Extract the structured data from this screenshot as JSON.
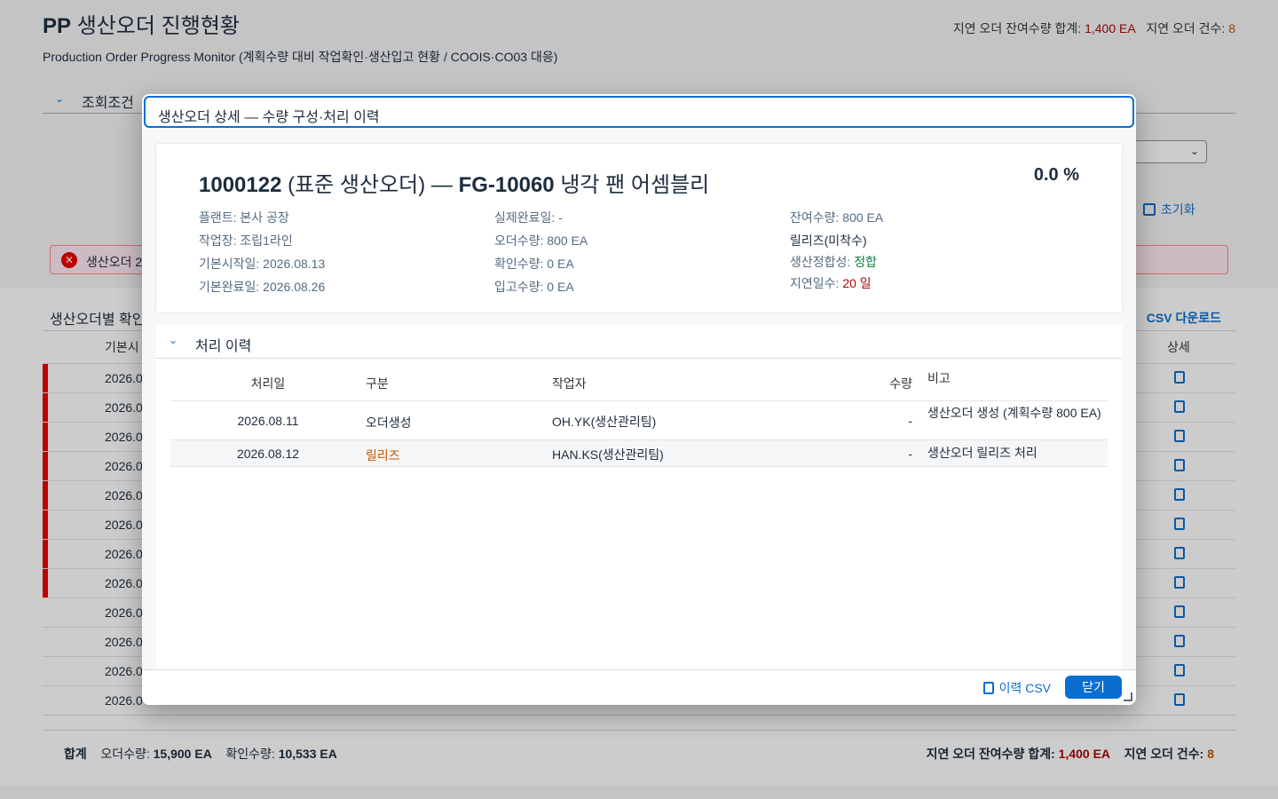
{
  "page": {
    "title_bold": "PP",
    "title_rest": "생산오더 진행현황",
    "subtitle": "Production Order Progress Monitor (계획수량 대비 작업확인·생산입고 현황 / COOIS·CO03 대응)",
    "kpi_label_1": "지연 오더 잔여수량 합계:",
    "kpi_value_1": "1,400 EA",
    "kpi_label_2": "지연 오더 건수:",
    "kpi_value_2": "8",
    "filter_label": "조회조건",
    "reset_label": "초기화",
    "error_text": "생산오더 2",
    "table_title": "생산오더별 확인",
    "csv_download": "CSV 다운로드",
    "col_start": "기본시",
    "col_detail": "상세",
    "row_dates": [
      "2026.0",
      "2026.0",
      "2026.0",
      "2026.0",
      "2026.0",
      "2026.0",
      "2026.0",
      "2026.0",
      "2026.0",
      "2026.0",
      "2026.0",
      "2026.0"
    ],
    "footer": {
      "sum_label": "합계",
      "order_qty_label": "오더수량:",
      "order_qty": "15,900 EA",
      "confirm_qty_label": "확인수량:",
      "confirm_qty": "10,533 EA",
      "delay_rem_label": "지연 오더 잔여수량 합계:",
      "delay_rem": "1,400 EA",
      "delay_cnt_label": "지연 오더 건수:",
      "delay_cnt": "8"
    }
  },
  "dialog": {
    "title": "생산오더 상세 — 수량 구성·처리 이력",
    "header_main": "1000122",
    "header_type": "(표준 생산오더) —",
    "header_material": "FG-10060",
    "header_desc": "냉각 팬 어셈블리",
    "percent": "0.0 %",
    "attrs_col1": [
      "플랜트: 본사 공장",
      "작업장: 조립1라인",
      "기본시작일: 2026.08.13",
      "기본완료일: 2026.08.26"
    ],
    "attrs_col2": [
      "실제완료일: -",
      "오더수량: 800 EA",
      "확인수량: 0 EA",
      "입고수량: 0 EA"
    ],
    "remaining": "잔여수량: 800 EA",
    "status": "릴리즈(미착수)",
    "consistency_label": "생산정합성:",
    "consistency_value": "정합",
    "delay_label": "지연일수:",
    "delay_value": "20 일",
    "history_section": "처리 이력",
    "history_cols": {
      "date": "처리일",
      "type": "구분",
      "user": "작업자",
      "qty": "수량",
      "note": "비고"
    },
    "history_rows": [
      {
        "date": "2026.08.11",
        "type": "오더생성",
        "user": "OH.YK(생산관리팀)",
        "qty": "-",
        "note": "생산오더 생성 (계획수량 800 EA)"
      },
      {
        "date": "2026.08.12",
        "type": "릴리즈",
        "user": "HAN.KS(생산관리팀)",
        "qty": "-",
        "note": "생산오더 릴리즈 처리"
      }
    ],
    "btn_history_csv": "이력 CSV",
    "btn_close": "닫기"
  },
  "colors": {
    "accent": "#0a6ed1",
    "danger": "#aa0808",
    "warning": "#c35500",
    "positive": "#107e3e"
  }
}
